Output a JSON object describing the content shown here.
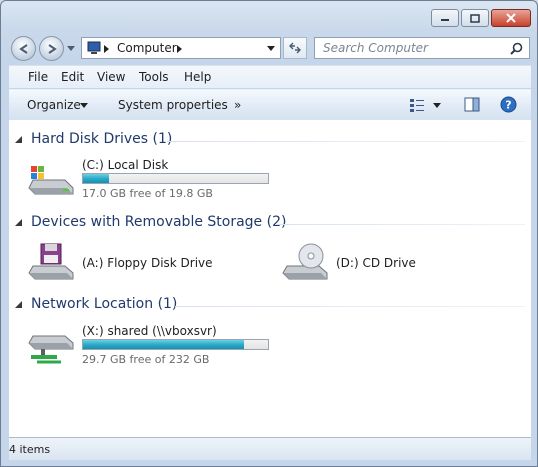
{
  "address": {
    "location": "Computer"
  },
  "search": {
    "placeholder": "Search Computer"
  },
  "menu": [
    "File",
    "Edit",
    "View",
    "Tools",
    "Help"
  ],
  "toolbar": {
    "organize": "Organize",
    "system_properties": "System properties",
    "more": "»"
  },
  "groups": [
    {
      "title": "Hard Disk Drives (1)"
    },
    {
      "title": "Devices with Removable Storage (2)"
    },
    {
      "title": "Network Location (1)"
    }
  ],
  "drives": {
    "local_disk": {
      "name": "(C:) Local Disk",
      "free_text": "17.0 GB free of 19.8 GB",
      "used_fraction": 0.14
    },
    "floppy": {
      "name": "(A:) Floppy Disk Drive"
    },
    "cd": {
      "name": "(D:) CD Drive"
    },
    "network": {
      "name": "(X:) shared (\\\\vboxsvr)",
      "free_text": "29.7 GB free of 232 GB",
      "used_fraction": 0.87
    }
  },
  "status": {
    "count": "4 items"
  },
  "colors": {
    "accent": "#1f3a6b",
    "bar_fill": "#28a7c6",
    "close": "#c8412b"
  },
  "icons": [
    "minimize-icon",
    "maximize-icon",
    "close-icon",
    "back-icon",
    "forward-icon",
    "computer-icon",
    "refresh-icon",
    "search-icon",
    "view-icon",
    "preview-pane-icon",
    "help-icon",
    "drive-icon",
    "floppy-icon",
    "cd-icon",
    "network-drive-icon"
  ]
}
